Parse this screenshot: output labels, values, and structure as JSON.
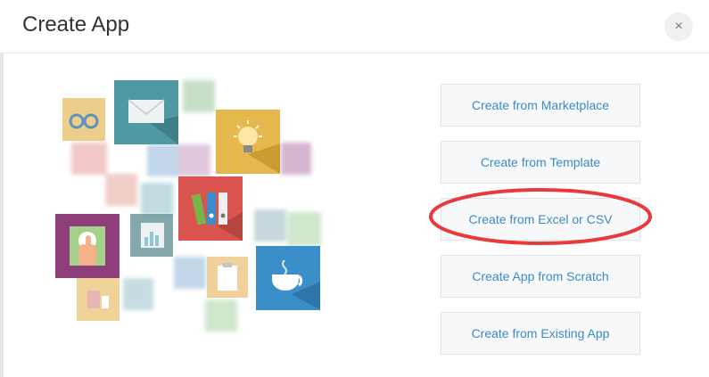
{
  "dialog": {
    "title": "Create App",
    "close_label": "×"
  },
  "options": [
    {
      "label": "Create from Marketplace"
    },
    {
      "label": "Create from Template"
    },
    {
      "label": "Create from Excel or CSV",
      "highlighted": true
    },
    {
      "label": "Create App from Scratch"
    },
    {
      "label": "Create from Existing App"
    }
  ],
  "colors": {
    "title_text": "#333333",
    "option_text": "#3d8bc1",
    "option_background": "#f6f8fa",
    "highlight_ring": "#e8393c",
    "tile_teal": "#4f9aa2",
    "tile_yellow": "#e4b84c",
    "tile_red": "#d9534f",
    "tile_purple": "#8e3f7a",
    "tile_blue": "#3b8fc9"
  },
  "icons": [
    "glasses-icon",
    "envelope-icon",
    "lightbulb-icon",
    "binders-icon",
    "hand-touch-icon",
    "coffee-cup-icon",
    "chart-icon",
    "clipboard-icon"
  ]
}
